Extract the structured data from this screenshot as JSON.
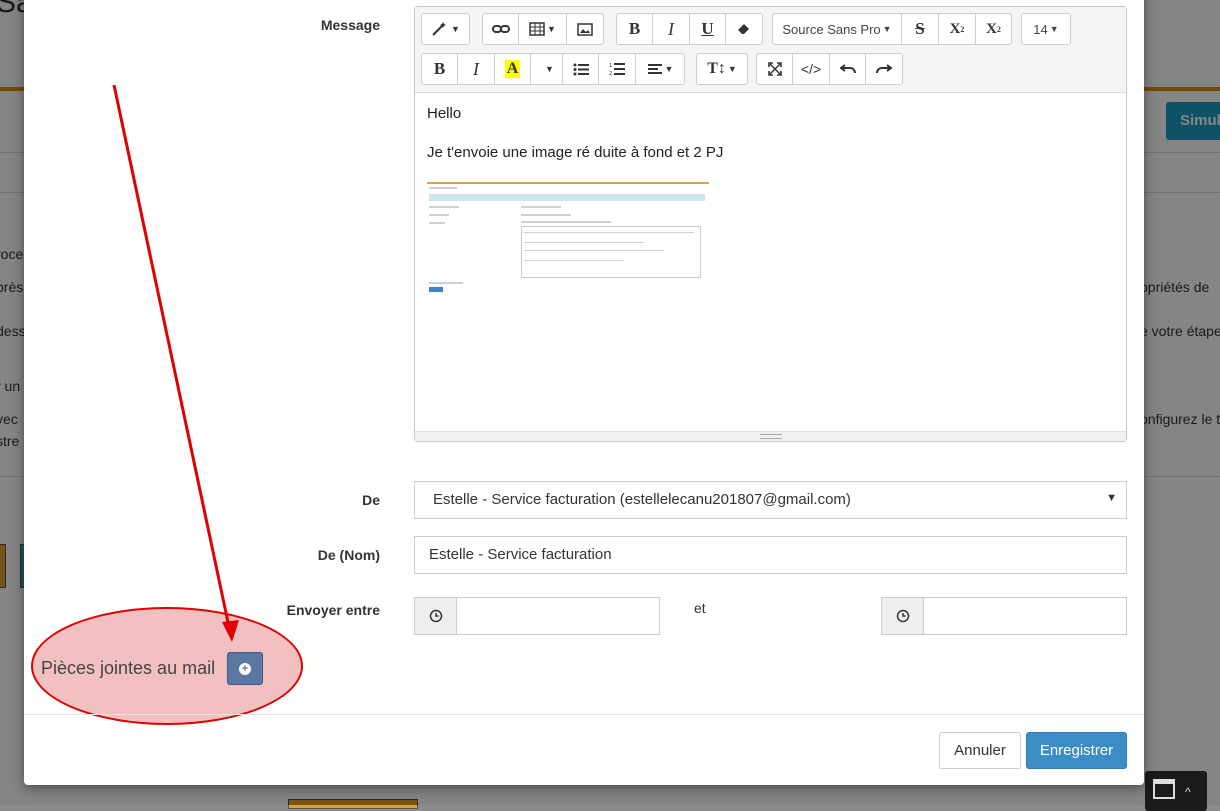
{
  "background": {
    "title_fragment": "Sa",
    "simulate_button": "Simul",
    "left_fragments": [
      "roce",
      "près",
      "dess",
      "r un",
      "vec",
      "stre"
    ],
    "right_fragments": [
      "opriétés de",
      "e votre étape",
      "onfigurez le t"
    ]
  },
  "modal": {
    "labels": {
      "message": "Message",
      "from": "De",
      "from_name": "De (Nom)",
      "send_between": "Envoyer entre",
      "and": "et"
    },
    "toolbar": {
      "font_name": "Source Sans Pro",
      "font_size": "14",
      "bold": "B",
      "italic": "I",
      "underline": "U",
      "strike": "S",
      "superscript": "X",
      "superscript_mark": "2",
      "subscript": "X",
      "subscript_mark": "2",
      "highlight": "A",
      "text_height": "T↕",
      "code": "</>"
    },
    "editor": {
      "paragraphs": [
        "Hello",
        "Je t'envoie une image ré duite à fond et 2 PJ"
      ]
    },
    "from_select": {
      "value": "Estelle - Service facturation (estellelecanu201807@gmail.com)"
    },
    "from_name_input": {
      "value": "Estelle -  Service facturation"
    },
    "send_between": {
      "start": "",
      "end": ""
    },
    "attachments": {
      "label": "Pièces jointes au mail"
    },
    "buttons": {
      "cancel": "Annuler",
      "save": "Enregistrer"
    }
  },
  "colors": {
    "primary": "#3c8dc5",
    "annotation": "#e00000",
    "attach_button": "#5b77a2",
    "highlight": "#ffff00"
  }
}
